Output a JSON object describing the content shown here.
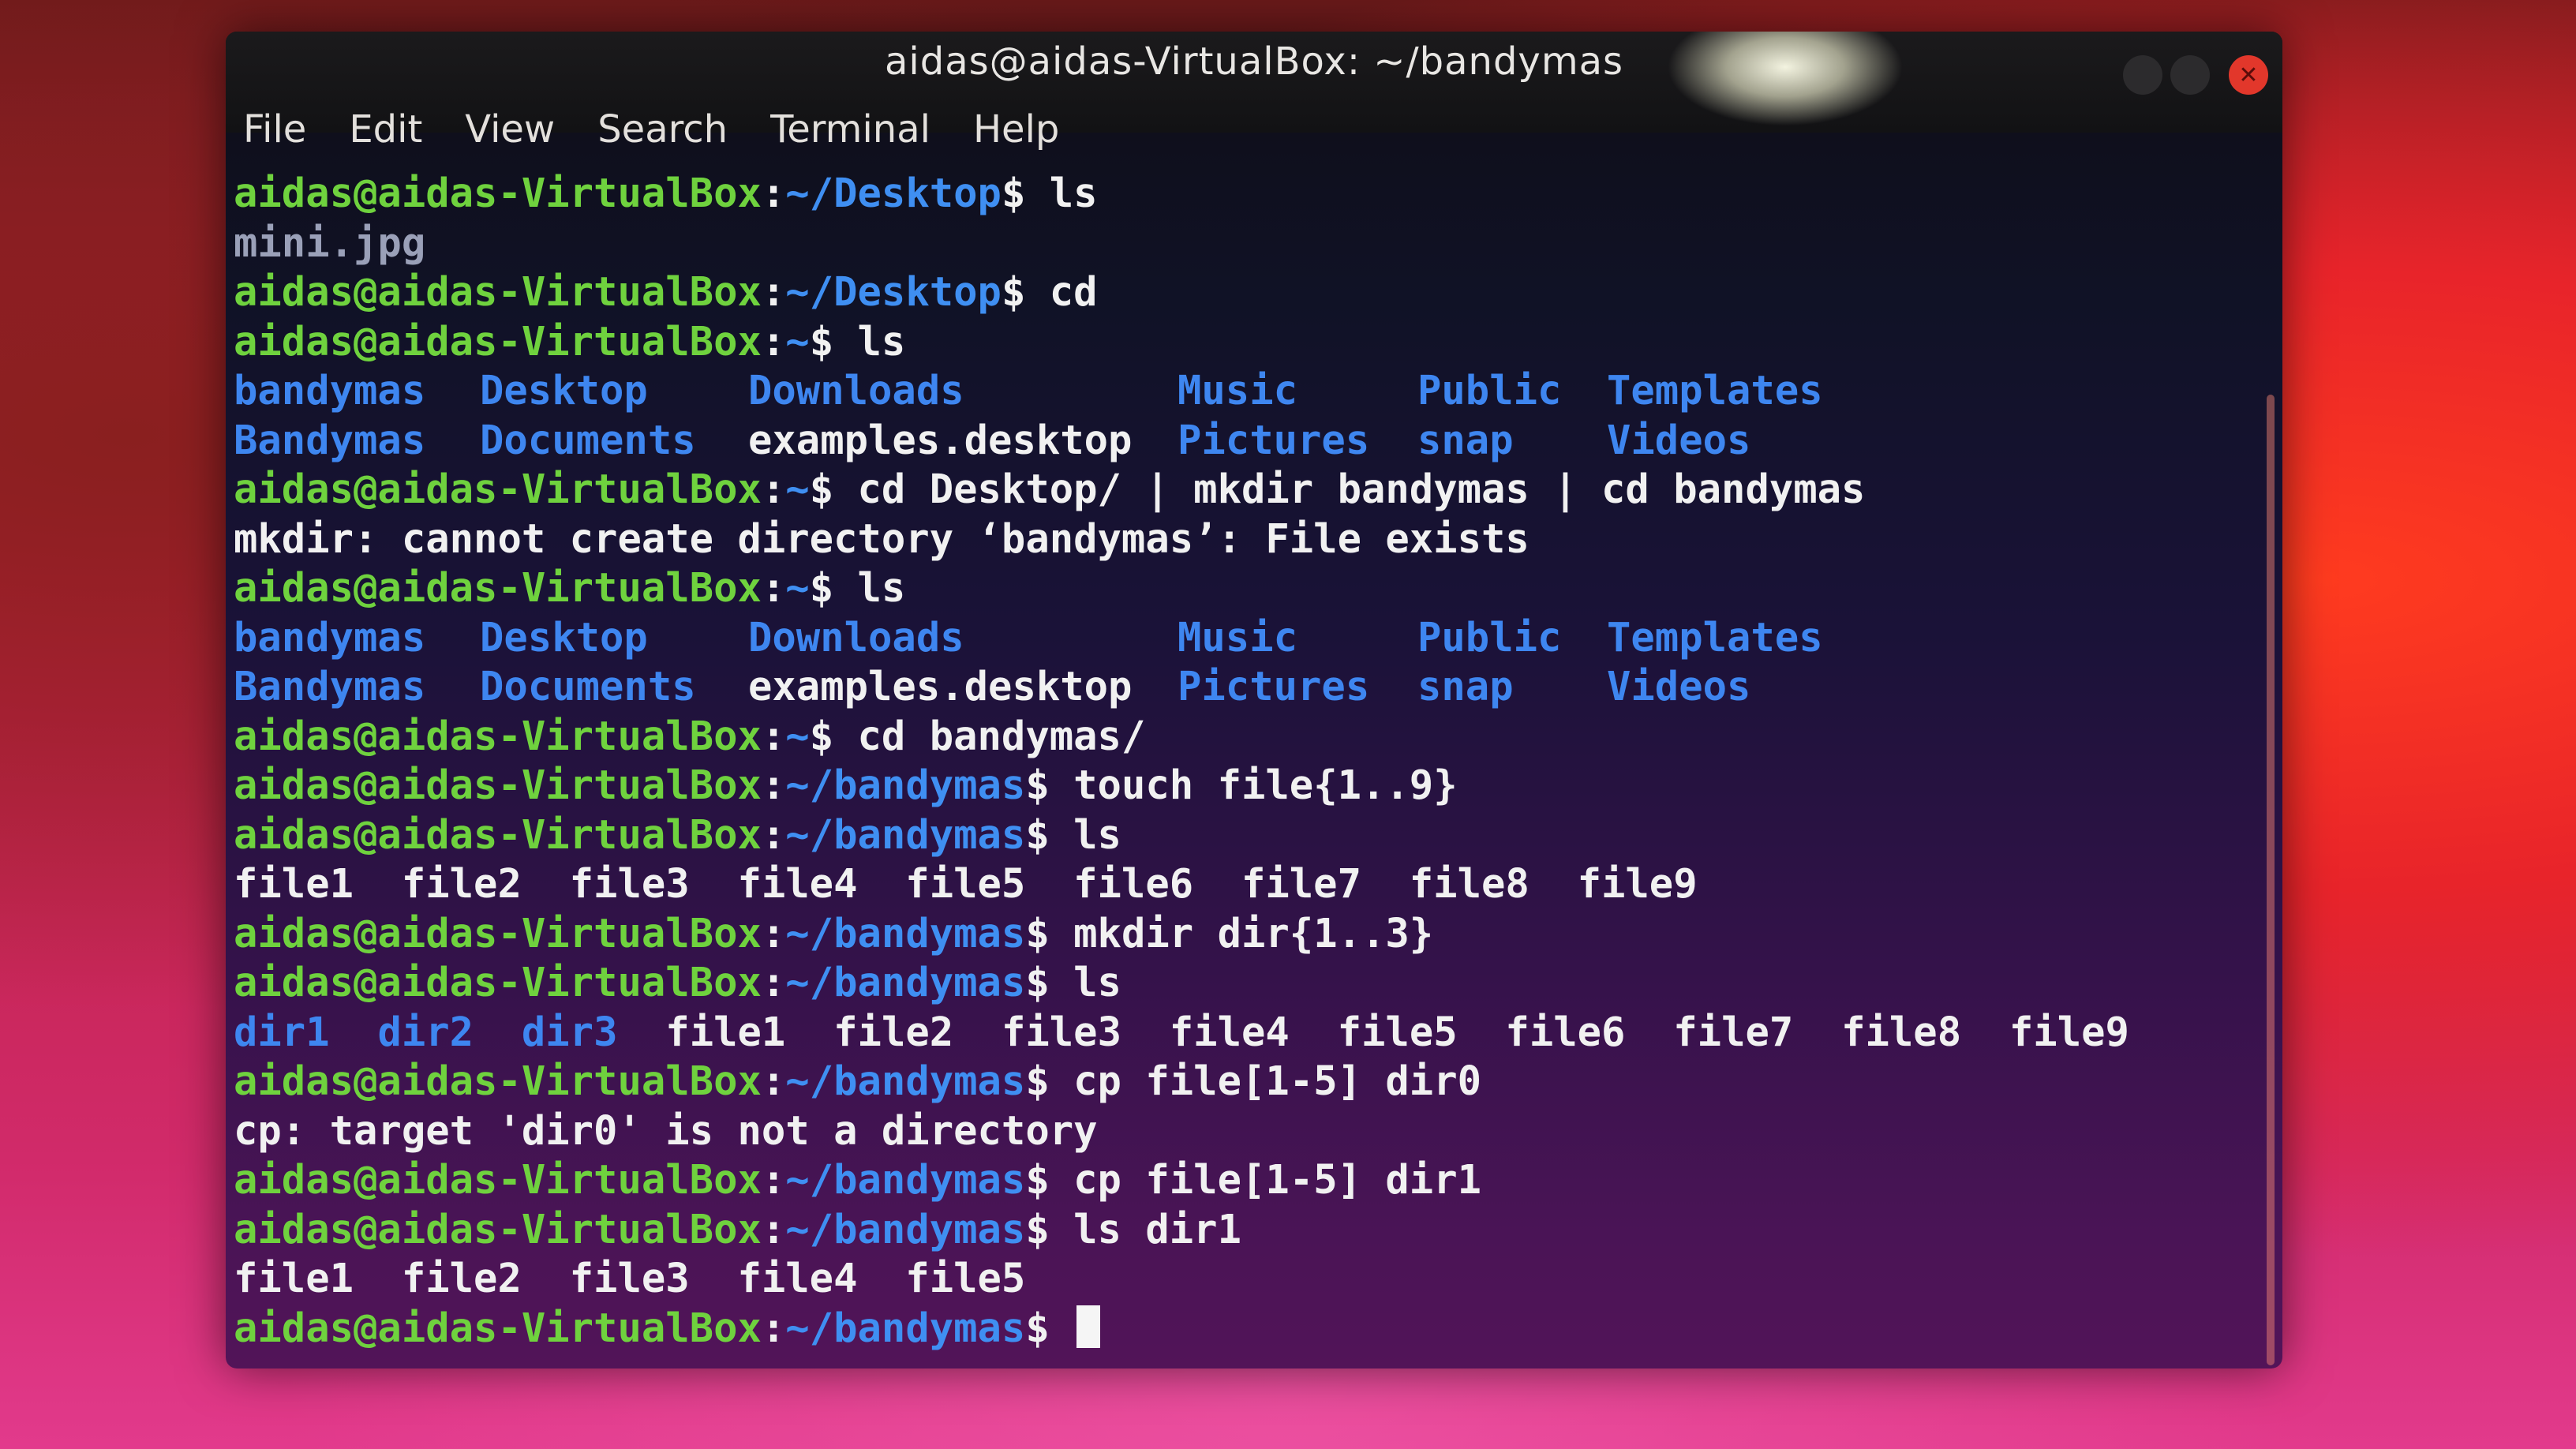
{
  "window": {
    "title": "aidas@aidas-VirtualBox: ~/bandymas"
  },
  "menu": {
    "items": [
      "File",
      "Edit",
      "View",
      "Search",
      "Terminal",
      "Help"
    ]
  },
  "controls": {
    "close_glyph": "✕"
  },
  "colors": {
    "prompt_user": "#6fd23e",
    "prompt_path": "#3f8ff2",
    "directory": "#3e86f0",
    "text": "#f1f1f1",
    "close_button": "#e2372b"
  },
  "terminal": {
    "lines": [
      {
        "type": "cmd",
        "user": "aidas@aidas-VirtualBox",
        "path": "~/Desktop",
        "cmd": " ls"
      },
      {
        "type": "out",
        "text": "mini.jpg",
        "style": "gray"
      },
      {
        "type": "cmd",
        "user": "aidas@aidas-VirtualBox",
        "path": "~/Desktop",
        "cmd": " cd"
      },
      {
        "type": "cmd",
        "user": "aidas@aidas-VirtualBox",
        "path": "~",
        "cmd": " ls"
      },
      {
        "type": "ls",
        "items": [
          {
            "t": "bandymas",
            "c": "d"
          },
          {
            "t": "Desktop",
            "c": "d"
          },
          {
            "t": "Downloads",
            "c": "d"
          },
          {
            "t": "Music",
            "c": "d"
          },
          {
            "t": "Public",
            "c": "d"
          },
          {
            "t": "Templates",
            "c": "d"
          }
        ]
      },
      {
        "type": "ls",
        "items": [
          {
            "t": "Bandymas",
            "c": "d"
          },
          {
            "t": "Documents",
            "c": "d"
          },
          {
            "t": "examples.desktop",
            "c": "w"
          },
          {
            "t": "Pictures",
            "c": "d"
          },
          {
            "t": "snap",
            "c": "d"
          },
          {
            "t": "Videos",
            "c": "d"
          }
        ]
      },
      {
        "type": "cmd",
        "user": "aidas@aidas-VirtualBox",
        "path": "~",
        "cmd": " cd Desktop/ | mkdir bandymas | cd bandymas"
      },
      {
        "type": "out",
        "text": "mkdir: cannot create directory ‘bandymas’: File exists",
        "style": "w"
      },
      {
        "type": "cmd",
        "user": "aidas@aidas-VirtualBox",
        "path": "~",
        "cmd": " ls"
      },
      {
        "type": "ls",
        "items": [
          {
            "t": "bandymas",
            "c": "d"
          },
          {
            "t": "Desktop",
            "c": "d"
          },
          {
            "t": "Downloads",
            "c": "d"
          },
          {
            "t": "Music",
            "c": "d"
          },
          {
            "t": "Public",
            "c": "d"
          },
          {
            "t": "Templates",
            "c": "d"
          }
        ]
      },
      {
        "type": "ls",
        "items": [
          {
            "t": "Bandymas",
            "c": "d"
          },
          {
            "t": "Documents",
            "c": "d"
          },
          {
            "t": "examples.desktop",
            "c": "w"
          },
          {
            "t": "Pictures",
            "c": "d"
          },
          {
            "t": "snap",
            "c": "d"
          },
          {
            "t": "Videos",
            "c": "d"
          }
        ]
      },
      {
        "type": "cmd",
        "user": "aidas@aidas-VirtualBox",
        "path": "~",
        "cmd": " cd bandymas/"
      },
      {
        "type": "cmd",
        "user": "aidas@aidas-VirtualBox",
        "path": "~/bandymas",
        "cmd": " touch file{1..9}"
      },
      {
        "type": "cmd",
        "user": "aidas@aidas-VirtualBox",
        "path": "~/bandymas",
        "cmd": " ls"
      },
      {
        "type": "out",
        "text": "file1  file2  file3  file4  file5  file6  file7  file8  file9",
        "style": "w"
      },
      {
        "type": "cmd",
        "user": "aidas@aidas-VirtualBox",
        "path": "~/bandymas",
        "cmd": " mkdir dir{1..3}"
      },
      {
        "type": "cmd",
        "user": "aidas@aidas-VirtualBox",
        "path": "~/bandymas",
        "cmd": " ls"
      },
      {
        "type": "mixed",
        "items": [
          {
            "t": "dir1",
            "c": "d"
          },
          {
            "t": "  ",
            "c": "w"
          },
          {
            "t": "dir2",
            "c": "d"
          },
          {
            "t": "  ",
            "c": "w"
          },
          {
            "t": "dir3",
            "c": "d"
          },
          {
            "t": "  file1  file2  file3  file4  file5  file6  file7  file8  file9",
            "c": "w"
          }
        ]
      },
      {
        "type": "cmd",
        "user": "aidas@aidas-VirtualBox",
        "path": "~/bandymas",
        "cmd": " cp file[1-5] dir0"
      },
      {
        "type": "out",
        "text": "cp: target 'dir0' is not a directory",
        "style": "w"
      },
      {
        "type": "cmd",
        "user": "aidas@aidas-VirtualBox",
        "path": "~/bandymas",
        "cmd": " cp file[1-5] dir1"
      },
      {
        "type": "cmd",
        "user": "aidas@aidas-VirtualBox",
        "path": "~/bandymas",
        "cmd": " ls dir1"
      },
      {
        "type": "out",
        "text": "file1  file2  file3  file4  file5",
        "style": "w"
      },
      {
        "type": "prompt",
        "user": "aidas@aidas-VirtualBox",
        "path": "~/bandymas",
        "cmd": " "
      }
    ]
  }
}
